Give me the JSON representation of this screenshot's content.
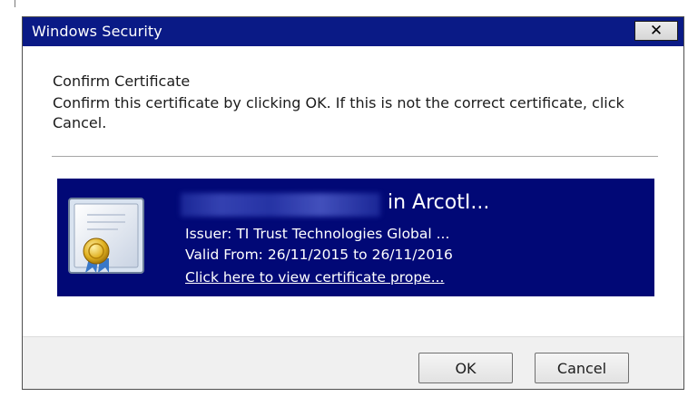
{
  "window": {
    "title": "Windows Security",
    "close_label": "✕"
  },
  "dialog": {
    "heading": "Confirm Certificate",
    "message": "Confirm this certificate by clicking OK. If this is not the correct certificate, click Cancel."
  },
  "certificate": {
    "name_visible": "in ArcotI...",
    "issuer": "Issuer: TI Trust Technologies Global ...",
    "valid": "Valid From: 26/11/2015 to 26/11/2016",
    "link": "Click here to view certificate prope..."
  },
  "buttons": {
    "ok": "OK",
    "cancel": "Cancel"
  },
  "colors": {
    "titlebar": "#0a1a86",
    "tile": "#010876",
    "footer": "#f0f0f0"
  },
  "icons": {
    "certificate": "certificate-icon"
  }
}
